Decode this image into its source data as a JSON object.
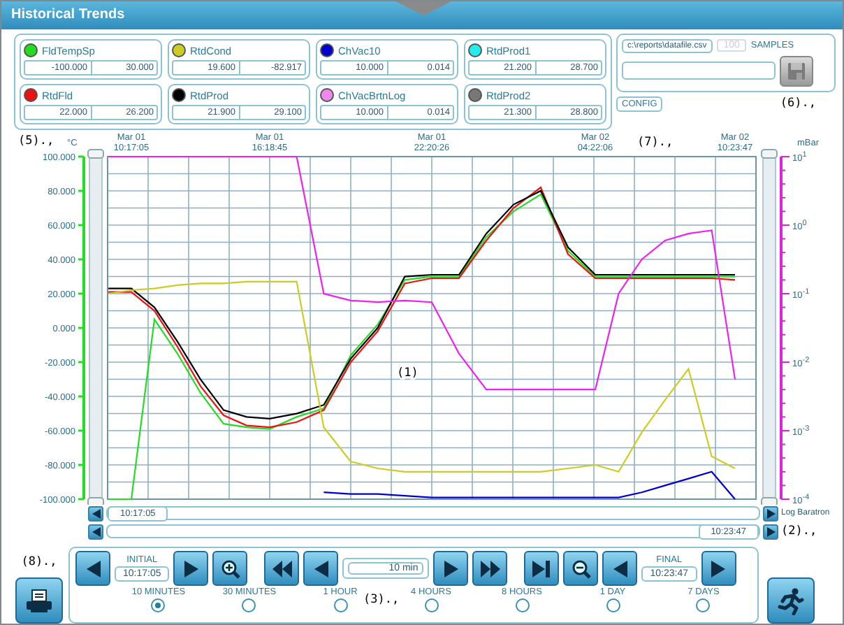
{
  "window": {
    "title": "Historical Trends"
  },
  "legend": [
    {
      "name": "FldTempSp",
      "color": "#22dd22",
      "min": "-100.000",
      "max": "30.000"
    },
    {
      "name": "RtdCond",
      "color": "#cccc22",
      "min": "19.600",
      "max": "-82.917"
    },
    {
      "name": "ChVac10",
      "color": "#0000cc",
      "min": "10.000",
      "max": "0.014"
    },
    {
      "name": "RtdProd1",
      "color": "#22eeee",
      "min": "21.200",
      "max": "28.700"
    },
    {
      "name": "RtdFld",
      "color": "#ee1111",
      "min": "22.000",
      "max": "26.200"
    },
    {
      "name": "RtdProd",
      "color": "#000000",
      "min": "21.900",
      "max": "29.100"
    },
    {
      "name": "ChVacBrtnLog",
      "color": "#ee88ee",
      "min": "10.000",
      "max": "0.014"
    },
    {
      "name": "RtdProd2",
      "color": "#777777",
      "min": "21.300",
      "max": "28.800"
    }
  ],
  "export": {
    "file": "c:\\reports\\datafile.csv",
    "samples": "100",
    "samples_label": "SAMPLES",
    "samples_disabled": true
  },
  "config_button": "CONFIG",
  "callouts": [
    "(5).,",
    "(7).,",
    "(1)",
    "(6).,",
    "(2).,",
    "(3).,",
    "(8).,"
  ],
  "chart": {
    "chart_data": {
      "type": "line",
      "ylabel": "°C",
      "categories": [
        null,
        "Mar 01\n10:17:05",
        null,
        null,
        null,
        null,
        null,
        "Mar 01\n16:18:45",
        null,
        null,
        null,
        null,
        null,
        "Mar 01\n22:20:26",
        null,
        null,
        null,
        null,
        null,
        "Mar 02\n04:22:06",
        null,
        null,
        null,
        null,
        null,
        "Mar 02\n10:23:47"
      ],
      "grid": true,
      "ylim": [
        -100,
        100
      ],
      "yticks": [
        {
          "value": 100,
          "label": "100.000"
        },
        {
          "value": 80,
          "label": "80.000"
        },
        {
          "value": 60,
          "label": "60.000"
        },
        {
          "value": 40,
          "label": "40.000"
        },
        {
          "value": 20,
          "label": "20.000"
        },
        {
          "value": 0,
          "label": "0.000"
        },
        {
          "value": -20,
          "label": "-20.000"
        },
        {
          "value": -40,
          "label": "-40.000"
        },
        {
          "value": -60,
          "label": "-60.000"
        },
        {
          "value": -80,
          "label": "-80.000"
        },
        {
          "value": -100,
          "label": "-100.000"
        }
      ],
      "series": [
        {
          "color": "#22dd22",
          "values": [
            -100,
            -100,
            5,
            -15,
            -38,
            -56,
            -58,
            -59,
            -52,
            -47,
            -16,
            2,
            28,
            30,
            30,
            53,
            68,
            78,
            45,
            30,
            30,
            30,
            30,
            30,
            30,
            30
          ]
        },
        {
          "color": "#ee1111",
          "values": [
            21,
            21,
            10,
            -11,
            -34,
            -51,
            -57,
            -58,
            -55,
            -48,
            -20,
            -2,
            26,
            29,
            29,
            51,
            70,
            82,
            43,
            29,
            29,
            29,
            29,
            29,
            29,
            28
          ]
        },
        {
          "color": "#000000",
          "values": [
            23,
            23,
            12,
            -8,
            -30,
            -48,
            -52,
            -53,
            -50,
            -45,
            -18,
            0,
            30,
            31,
            31,
            55,
            72,
            80,
            47,
            31,
            31,
            31,
            31,
            31,
            31,
            31
          ]
        },
        {
          "color": "#cccc22",
          "values": [
            20,
            22,
            23,
            25,
            26,
            26,
            27,
            27,
            27,
            -58,
            -78,
            -82,
            -84,
            -84,
            -84,
            -84,
            -84,
            -84,
            -82,
            -80,
            -84,
            -61,
            -42,
            -24,
            -75,
            -82
          ]
        },
        {
          "color": "#0000cc",
          "values": [
            null,
            null,
            null,
            null,
            null,
            null,
            null,
            null,
            null,
            -96,
            -97,
            -97,
            -98,
            -99,
            -99,
            -99,
            -99,
            -99,
            -99,
            -99,
            -99,
            -96,
            -92,
            -88,
            -84,
            -100
          ]
        },
        {
          "color": "#ee22ee",
          "values": [
            100,
            100,
            100,
            100,
            100,
            100,
            100,
            100,
            100,
            20,
            16,
            15,
            16,
            15,
            -15,
            -36,
            -36,
            -36,
            -36,
            -36,
            20,
            40,
            51,
            55,
            57,
            -30
          ]
        }
      ]
    },
    "right_axis": {
      "unit": "mBar",
      "ticks": [
        {
          "base": "10",
          "exp": "1"
        },
        {
          "base": "10",
          "exp": "0"
        },
        {
          "base": "10",
          "exp": "-1"
        },
        {
          "base": "10",
          "exp": "-2"
        },
        {
          "base": "10",
          "exp": "-3"
        },
        {
          "base": "10",
          "exp": "-4"
        }
      ]
    }
  },
  "scroll": {
    "start": "10:17:05",
    "axis_name": "Log Baratron",
    "end": "10:23:47"
  },
  "navigation": [
    {
      "kind": "back"
    },
    {
      "kind": "time",
      "label": "INITIAL",
      "value": "10:17:05"
    },
    {
      "kind": "forward"
    },
    {
      "kind": "zoom-in"
    },
    {
      "kind": "rewind"
    },
    {
      "kind": "back"
    },
    {
      "kind": "span",
      "value": "10 min"
    },
    {
      "kind": "forward"
    },
    {
      "kind": "fast-forward"
    },
    {
      "kind": "skip-end"
    },
    {
      "kind": "zoom-out"
    },
    {
      "kind": "back"
    },
    {
      "kind": "time",
      "label": "FINAL",
      "value": "10:23:47"
    },
    {
      "kind": "forward"
    }
  ],
  "ranges": [
    {
      "label": "10 MINUTES",
      "selected": true
    },
    {
      "label": "30 MINUTES",
      "selected": false
    },
    {
      "label": "1 HOUR",
      "selected": false
    },
    {
      "label": "4 HOURS",
      "selected": false
    },
    {
      "label": "8 HOURS",
      "selected": false
    },
    {
      "label": "1 DAY",
      "selected": false
    },
    {
      "label": "7 DAYS",
      "selected": false
    }
  ]
}
